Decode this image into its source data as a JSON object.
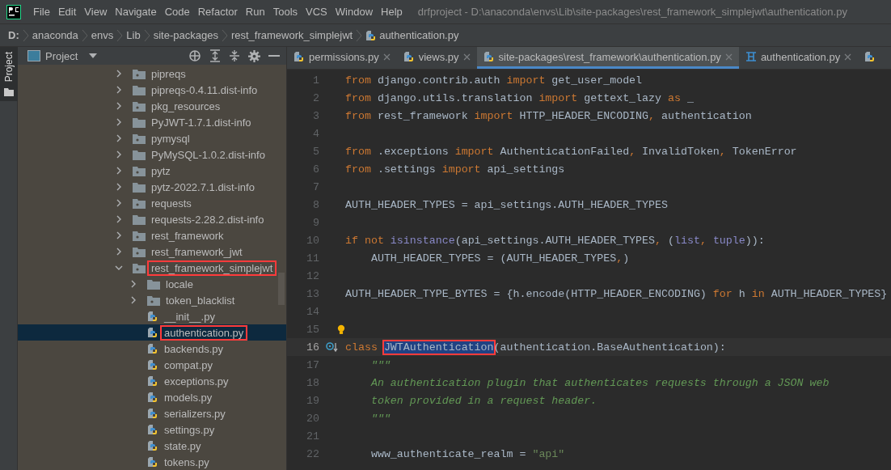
{
  "menu_bar": {
    "items": [
      "File",
      "Edit",
      "View",
      "Navigate",
      "Code",
      "Refactor",
      "Run",
      "Tools",
      "VCS",
      "Window",
      "Help"
    ],
    "title": "drfproject - D:\\anaconda\\envs\\Lib\\site-packages\\rest_framework_simplejwt\\authentication.py"
  },
  "breadcrumb": [
    {
      "label": "D:",
      "kind": "drive"
    },
    {
      "label": "anaconda",
      "kind": "folder"
    },
    {
      "label": "envs",
      "kind": "folder"
    },
    {
      "label": "Lib",
      "kind": "folder"
    },
    {
      "label": "site-packages",
      "kind": "folder"
    },
    {
      "label": "rest_framework_simplejwt",
      "kind": "folder"
    },
    {
      "label": "authentication.py",
      "kind": "file"
    }
  ],
  "side_stripe": {
    "label": "Project"
  },
  "project_panel": {
    "title": "Project",
    "tree": [
      {
        "label": "pipreqs",
        "kind": "package",
        "expanded": false,
        "selected": false,
        "highlighted": false
      },
      {
        "label": "pipreqs-0.4.11.dist-info",
        "kind": "folder",
        "expanded": false,
        "selected": false,
        "highlighted": false
      },
      {
        "label": "pkg_resources",
        "kind": "package",
        "expanded": false,
        "selected": false,
        "highlighted": false
      },
      {
        "label": "PyJWT-1.7.1.dist-info",
        "kind": "folder",
        "expanded": false,
        "selected": false,
        "highlighted": false
      },
      {
        "label": "pymysql",
        "kind": "package",
        "expanded": false,
        "selected": false,
        "highlighted": false
      },
      {
        "label": "PyMySQL-1.0.2.dist-info",
        "kind": "folder",
        "expanded": false,
        "selected": false,
        "highlighted": false
      },
      {
        "label": "pytz",
        "kind": "package",
        "expanded": false,
        "selected": false,
        "highlighted": false
      },
      {
        "label": "pytz-2022.7.1.dist-info",
        "kind": "folder",
        "expanded": false,
        "selected": false,
        "highlighted": false
      },
      {
        "label": "requests",
        "kind": "package",
        "expanded": false,
        "selected": false,
        "highlighted": false
      },
      {
        "label": "requests-2.28.2.dist-info",
        "kind": "folder",
        "expanded": false,
        "selected": false,
        "highlighted": false
      },
      {
        "label": "rest_framework",
        "kind": "package",
        "expanded": false,
        "selected": false,
        "highlighted": false
      },
      {
        "label": "rest_framework_jwt",
        "kind": "package",
        "expanded": false,
        "selected": false,
        "highlighted": false
      },
      {
        "label": "rest_framework_simplejwt",
        "kind": "package",
        "expanded": true,
        "selected": false,
        "highlighted": true,
        "children": [
          {
            "label": "locale",
            "kind": "folder",
            "expanded": false,
            "selected": false,
            "highlighted": false
          },
          {
            "label": "token_blacklist",
            "kind": "package",
            "expanded": false,
            "selected": false,
            "highlighted": false
          },
          {
            "label": "__init__.py",
            "kind": "file",
            "selected": false,
            "highlighted": false
          },
          {
            "label": "authentication.py",
            "kind": "file",
            "selected": true,
            "highlighted": true
          },
          {
            "label": "backends.py",
            "kind": "file",
            "selected": false,
            "highlighted": false
          },
          {
            "label": "compat.py",
            "kind": "file",
            "selected": false,
            "highlighted": false
          },
          {
            "label": "exceptions.py",
            "kind": "file",
            "selected": false,
            "highlighted": false
          },
          {
            "label": "models.py",
            "kind": "file",
            "selected": false,
            "highlighted": false
          },
          {
            "label": "serializers.py",
            "kind": "file",
            "selected": false,
            "highlighted": false
          },
          {
            "label": "settings.py",
            "kind": "file",
            "selected": false,
            "highlighted": false
          },
          {
            "label": "state.py",
            "kind": "file",
            "selected": false,
            "highlighted": false
          },
          {
            "label": "tokens.py",
            "kind": "file",
            "selected": false,
            "highlighted": false
          }
        ]
      }
    ]
  },
  "editor_tabs": [
    {
      "label": "permissions.py",
      "kind": "python",
      "selected": false
    },
    {
      "label": "views.py",
      "kind": "python",
      "selected": false
    },
    {
      "label": "site-packages\\rest_framework\\authentication.py",
      "kind": "python",
      "selected": true
    },
    {
      "label": "authentication.py",
      "kind": "structure",
      "selected": false
    }
  ],
  "editor": {
    "lines": [
      {
        "number": "1",
        "tokens": [
          {
            "text": "from",
            "kind": "keyword"
          },
          {
            "text": " django.contrib.auth ",
            "kind": "plain"
          },
          {
            "text": "import",
            "kind": "keyword"
          },
          {
            "text": " get_user_model",
            "kind": "plain"
          }
        ]
      },
      {
        "number": "2",
        "tokens": [
          {
            "text": "from",
            "kind": "keyword"
          },
          {
            "text": " django.utils.translation ",
            "kind": "plain"
          },
          {
            "text": "import",
            "kind": "keyword"
          },
          {
            "text": " gettext_lazy ",
            "kind": "plain"
          },
          {
            "text": "as",
            "kind": "keyword"
          },
          {
            "text": " _",
            "kind": "plain"
          }
        ]
      },
      {
        "number": "3",
        "tokens": [
          {
            "text": "from",
            "kind": "keyword"
          },
          {
            "text": " rest_framework ",
            "kind": "plain"
          },
          {
            "text": "import",
            "kind": "keyword"
          },
          {
            "text": " HTTP_HEADER_ENCODING",
            "kind": "plain"
          },
          {
            "text": ",",
            "kind": "keyword"
          },
          {
            "text": " authentication",
            "kind": "plain"
          }
        ]
      },
      {
        "number": "4"
      },
      {
        "number": "5",
        "tokens": [
          {
            "text": "from",
            "kind": "keyword"
          },
          {
            "text": " .exceptions ",
            "kind": "plain"
          },
          {
            "text": "import",
            "kind": "keyword"
          },
          {
            "text": " AuthenticationFailed",
            "kind": "plain"
          },
          {
            "text": ",",
            "kind": "keyword"
          },
          {
            "text": " InvalidToken",
            "kind": "plain"
          },
          {
            "text": ",",
            "kind": "keyword"
          },
          {
            "text": " TokenError",
            "kind": "plain"
          }
        ]
      },
      {
        "number": "6",
        "tokens": [
          {
            "text": "from",
            "kind": "keyword"
          },
          {
            "text": " .settings ",
            "kind": "plain"
          },
          {
            "text": "import",
            "kind": "keyword"
          },
          {
            "text": " api_settings",
            "kind": "plain"
          }
        ]
      },
      {
        "number": "7"
      },
      {
        "number": "8",
        "tokens": [
          {
            "text": "AUTH_HEADER_TYPES = api_settings.AUTH_HEADER_TYPES",
            "kind": "plain"
          }
        ]
      },
      {
        "number": "9"
      },
      {
        "number": "10",
        "tokens": [
          {
            "text": "if not",
            "kind": "keyword"
          },
          {
            "text": " isinstance",
            "kind": "builtin"
          },
          {
            "text": "(api_settings.AUTH_HEADER_TYPES",
            "kind": "plain"
          },
          {
            "text": ",",
            "kind": "keyword"
          },
          {
            "text": " (",
            "kind": "plain"
          },
          {
            "text": "list",
            "kind": "builtin"
          },
          {
            "text": ",",
            "kind": "keyword"
          },
          {
            "text": " tuple",
            "kind": "builtin"
          },
          {
            "text": ")):",
            "kind": "plain"
          }
        ]
      },
      {
        "number": "11",
        "tokens": [
          {
            "text": "    AUTH_HEADER_TYPES = (AUTH_HEADER_TYPES",
            "kind": "plain"
          },
          {
            "text": ",",
            "kind": "keyword"
          },
          {
            "text": ")",
            "kind": "plain"
          }
        ]
      },
      {
        "number": "12"
      },
      {
        "number": "13",
        "tokens": [
          {
            "text": "AUTH_HEADER_TYPE_BYTES = {h.encode(HTTP_HEADER_ENCODING) ",
            "kind": "plain"
          },
          {
            "text": "for",
            "kind": "keyword"
          },
          {
            "text": " h ",
            "kind": "plain"
          },
          {
            "text": "in",
            "kind": "keyword"
          },
          {
            "text": " AUTH_HEADER_TYPES}",
            "kind": "plain"
          }
        ]
      },
      {
        "number": "14"
      },
      {
        "number": "15",
        "bulb": true
      },
      {
        "number": "16",
        "current": true,
        "tokens": [
          {
            "text": "class ",
            "kind": "keyword"
          },
          {
            "text": "JWTAuthentication",
            "kind": "selected"
          },
          {
            "text": "(authentication.BaseAuthentication):",
            "kind": "plain"
          }
        ]
      },
      {
        "number": "17",
        "tokens": [
          {
            "text": "    \"\"\"",
            "kind": "docstring"
          }
        ]
      },
      {
        "number": "18",
        "tokens": [
          {
            "text": "    An authentication plugin that authenticates requests through a JSON web",
            "kind": "docstring"
          }
        ]
      },
      {
        "number": "19",
        "tokens": [
          {
            "text": "    token provided in a request header.",
            "kind": "docstring"
          }
        ]
      },
      {
        "number": "20",
        "tokens": [
          {
            "text": "    \"\"\"",
            "kind": "docstring"
          }
        ]
      },
      {
        "number": "21"
      },
      {
        "number": "22",
        "tokens": [
          {
            "text": "    www_authenticate_realm = ",
            "kind": "plain"
          },
          {
            "text": "\"api\"",
            "kind": "string"
          }
        ]
      }
    ]
  }
}
